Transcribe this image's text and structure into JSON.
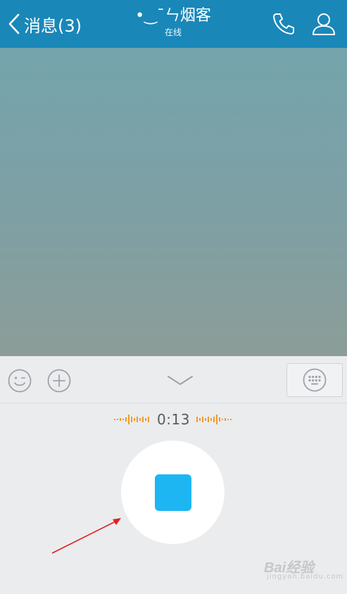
{
  "header": {
    "back_label": "消息(3)",
    "contact_name": "•‿¯ㄣ烟客",
    "status": "在线",
    "phone_icon": "phone-icon",
    "profile_icon": "person-icon"
  },
  "toolbar": {
    "emoji_icon": "emoji-icon",
    "plus_icon": "plus-circle-icon",
    "collapse_icon": "chevron-down-icon",
    "keyboard_icon": "keyboard-icon"
  },
  "recording": {
    "elapsed": "0:13",
    "stop_icon": "stop-icon"
  },
  "watermark": {
    "logo": "Bai经验",
    "sub": "jingyan.baidu.com"
  },
  "colors": {
    "header_bg": "#1a87b9",
    "accent_blue": "#1db6f2",
    "wave_orange": "#f39a2a",
    "annotation_red": "#e02020"
  }
}
